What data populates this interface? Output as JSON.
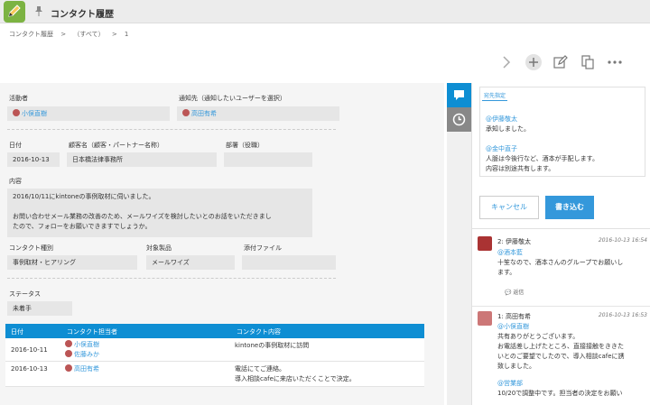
{
  "app": {
    "title": "コンタクト履歴"
  },
  "breadcrumb": [
    "コンタクト履歴",
    ">",
    "（すべて）",
    ">",
    "1"
  ],
  "toolbar": {
    "next": "chevron-right-icon",
    "add": "plus-icon",
    "edit": "pencil-icon",
    "copy": "copy-icon",
    "more": "more-icon"
  },
  "record": {
    "actor_label": "活動者",
    "actor_value": "小俣直樹",
    "notify_label": "通知先（通知したいユーザーを選択）",
    "notify_value": "高田有希",
    "date_label": "日付",
    "date_value": "2016-10-13",
    "customer_label": "顧客名（顧客・パートナー名称）",
    "customer_value": "日本橋法律事務所",
    "dept_label": "部署（役職）",
    "dept_value": "",
    "content_label": "内容",
    "content_lines": [
      "2016/10/11にkintoneの事例取材に伺いました。",
      "",
      "お問い合わせメール業務の改善のため、メールワイズを検討したいとのお話をいただきまし",
      "たので、フォローをお願いできますでしょうか。"
    ],
    "channel_label": "コンタクト種別",
    "channel_value": "事例取材・ヒアリング",
    "product_label": "対象製品",
    "product_value": "メールワイズ",
    "attach_label": "添付ファイル",
    "attach_value": "",
    "status_label": "ステータス",
    "status_value": "未着手"
  },
  "table": {
    "headers": [
      "日付",
      "コンタクト担当者",
      "コンタクト内容"
    ],
    "rows": [
      {
        "date": "2016-10-11",
        "users": [
          "小俣直樹",
          "佐藤みか"
        ],
        "content": [
          "kintoneの事例取材に訪問"
        ]
      },
      {
        "date": "2016-10-13",
        "users": [
          "高田有希"
        ],
        "content": [
          "電話にてご連絡。",
          "導入相談cafeに来店いただくことで決定。"
        ]
      }
    ]
  },
  "sidetabs": {
    "comments": "comment-icon",
    "history": "clock-icon"
  },
  "compose": {
    "notify_tag": "宛先指定",
    "lines": [
      {
        "text": "@伊藤敬太",
        "mention": true
      },
      {
        "text": "承知しました。",
        "mention": false
      },
      {
        "text": "",
        "mention": false
      },
      {
        "text": "@金中直子",
        "mention": true
      },
      {
        "text": "人脈は今後行など、酒本が手配します。",
        "mention": false
      },
      {
        "text": "内容は別途共有します。",
        "mention": false
      }
    ],
    "cancel": "キャンセル",
    "post": "書き込む"
  },
  "comments": [
    {
      "head": "2: 伊藤敬太",
      "time": "2016-10-13 16:54",
      "lines": [
        {
          "text": "@酒本藍",
          "mention": true
        },
        {
          "text": "十笙なので、酒本さんのグループでお願いし",
          "mention": false
        },
        {
          "text": "ます。",
          "mention": false
        }
      ],
      "reply": "返信"
    },
    {
      "head": "1: 高田有希",
      "time": "2016-10-13 16:53",
      "lines": [
        {
          "text": "@小俣直樹",
          "mention": true
        },
        {
          "text": "共有ありがとうございます。",
          "mention": false
        },
        {
          "text": "お電話差し上げたところ、直接接触をききた",
          "mention": false
        },
        {
          "text": "いとのご要望でしたので、導入相談cafeに誘",
          "mention": false
        },
        {
          "text": "致しました。",
          "mention": false
        },
        {
          "text": "",
          "mention": false
        },
        {
          "text": "@営業部",
          "mention": true
        },
        {
          "text": "10/20で調整中です。担当者の決定をお願い",
          "mention": false
        }
      ],
      "reply": ""
    }
  ]
}
